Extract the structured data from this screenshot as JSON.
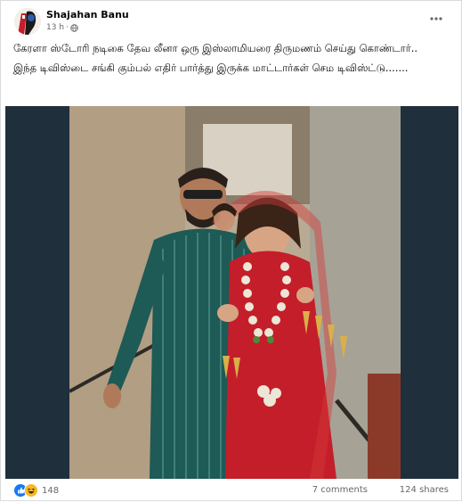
{
  "post": {
    "author": "Shajahan Banu",
    "time": "13 h",
    "visibility_icon": "globe-icon",
    "text_line1": "கேரளா ஸ்டோரி நடிகை தேவ லீனா ஒரு இஸ்லாமியரை திருமணம் செய்து கொண்டார்..",
    "text_line2": "இந்த டிவிஸ்டை சங்கி கும்பல் எதிர் பார்த்து இருக்க மாட்டார்கள் செம டிவிஸ்ட்டு......."
  },
  "footer": {
    "reaction_count": "148",
    "comments": "7 comments",
    "shares": "124 shares"
  },
  "colors": {
    "like_blue": "#1877f2",
    "haha_yellow": "#f7b928",
    "media_bg": "#1f2f3c",
    "muted": "#65676b"
  }
}
